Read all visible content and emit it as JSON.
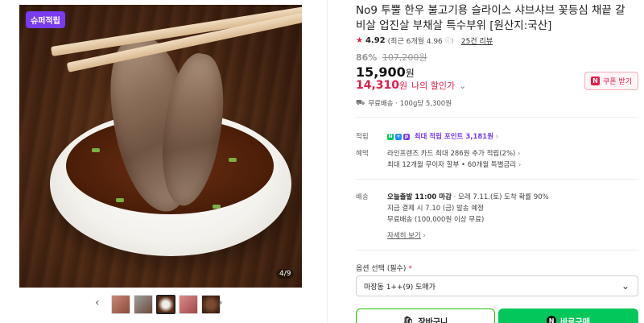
{
  "gallery": {
    "badge": "슈퍼적립",
    "counter": "4/9",
    "prev_icon": "‹",
    "next_icon": "›"
  },
  "product": {
    "title": "No9 투뿔 한우 불고기용 슬라이스 샤브샤브 꽃등심 채끝 갈비살 업진살 부채살 특수부위 [원산지:국산]",
    "rating_score": "4.92",
    "rating_note": "(최근 6개월 4.96",
    "review_count": "25건 리뷰",
    "discount_rate": "86%",
    "original_price": "107,200원",
    "price": "15,900",
    "price_unit": "원",
    "my_price": "14,310",
    "my_price_unit": "원",
    "my_price_label": "나의 할인가",
    "coupon_label": "쿠폰 받기",
    "delivery": "무료배송 · 100g당 5,300원"
  },
  "benefits": {
    "points_label": "적립",
    "points_text": "최대 적립 포인트 3,181원",
    "perks_label": "혜택",
    "perk1": "라인프렌즈 카드 최대 286원 추가 적립(2%)",
    "perk2": "최대 12개월 무이자 할부 • 60개월 특별금리",
    "shipping_label": "배송",
    "ship_bold": "오늘출발 11:00 마감",
    "ship_rest": "· 모레 7.11.(토) 도착 확률 90%",
    "ship_line2": "지금 결제 시 7.10 (금) 발송 예정",
    "ship_line3": "무료배송 (100,000원 이상 무료)",
    "details_link": "자세히 보기"
  },
  "options": {
    "label": "옵션 선택 (필수)",
    "required_mark": "*",
    "selected": "마장동 1++(9) 도매가"
  },
  "actions": {
    "cart": "장바구니",
    "buy": "바로구매"
  },
  "colors": {
    "accent_red": "#e11d48",
    "naver_green": "#03c75a",
    "purple": "#7a3cf0"
  }
}
